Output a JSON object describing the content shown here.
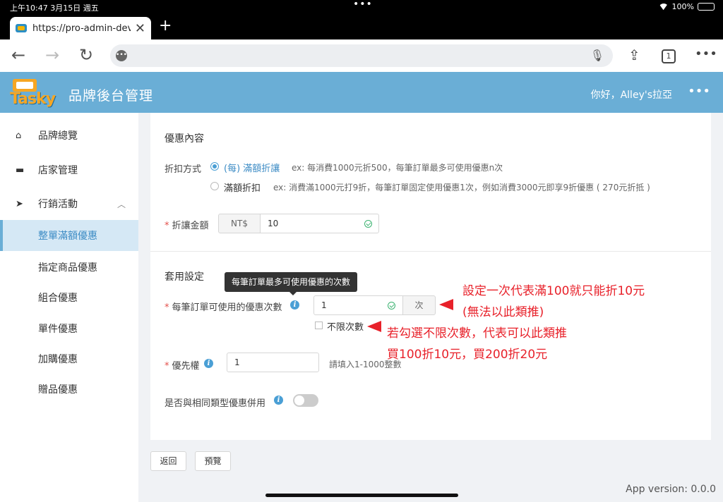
{
  "status_bar": {
    "time": "上午10:47  3月15日 週五",
    "battery": "100%"
  },
  "browser": {
    "tab_title": "https://pro-admin-dev.pc",
    "tabs_count": "1"
  },
  "app": {
    "logo_text": "Tasky",
    "title": "品牌後台管理",
    "greeting": "你好，Alley's拉亞"
  },
  "sidebar": {
    "items": [
      {
        "label": "品牌總覽",
        "icon": "home-icon"
      },
      {
        "label": "店家管理",
        "icon": "store-icon"
      },
      {
        "label": "行銷活動",
        "icon": "send-icon"
      },
      {
        "label": "整單滿額優惠",
        "active": true
      },
      {
        "label": "指定商品優惠"
      },
      {
        "label": "組合優惠"
      },
      {
        "label": "單件優惠"
      },
      {
        "label": "加購優惠"
      },
      {
        "label": "贈品優惠"
      }
    ]
  },
  "form": {
    "section_discount": "優惠內容",
    "method_label": "折扣方式",
    "option1_label": "(每) 滿額折讓",
    "option1_hint": "ex: 每消費1000元折500，每筆訂單最多可使用優惠n次",
    "option2_label": "滿額折扣",
    "option2_hint": "ex: 消費滿1000元打9折，每筆訂單固定使用優惠1次，例如消費3000元即享9折優惠 ( 270元折抵 )",
    "amount_label": "折讓金額",
    "amount_prefix": "NT$",
    "amount_value": "10",
    "section_apply": "套用設定",
    "tooltip": "每筆訂單最多可使用優惠的次數",
    "usage_label": "每筆訂單可使用的優惠次數",
    "usage_value": "1",
    "usage_suffix": "次",
    "unlimited_label": "不限次數",
    "priority_label": "優先權",
    "priority_value": "1",
    "priority_hint": "請填入1-1000整數",
    "combine_label": "是否與相同類型優惠併用"
  },
  "annotations": {
    "line1": "設定一次代表滿100就只能折10元",
    "line2": "(無法以此類推)",
    "line3": "若勾選不限次數，代表可以此類推",
    "line4": "買100折10元，買200折20元"
  },
  "actions": {
    "back": "返回",
    "preview": "預覽"
  },
  "version": "App version: 0.0.0",
  "colors": {
    "header": "#6aaed6",
    "accent": "#4a9fd5",
    "annotation": "#e8212a"
  }
}
